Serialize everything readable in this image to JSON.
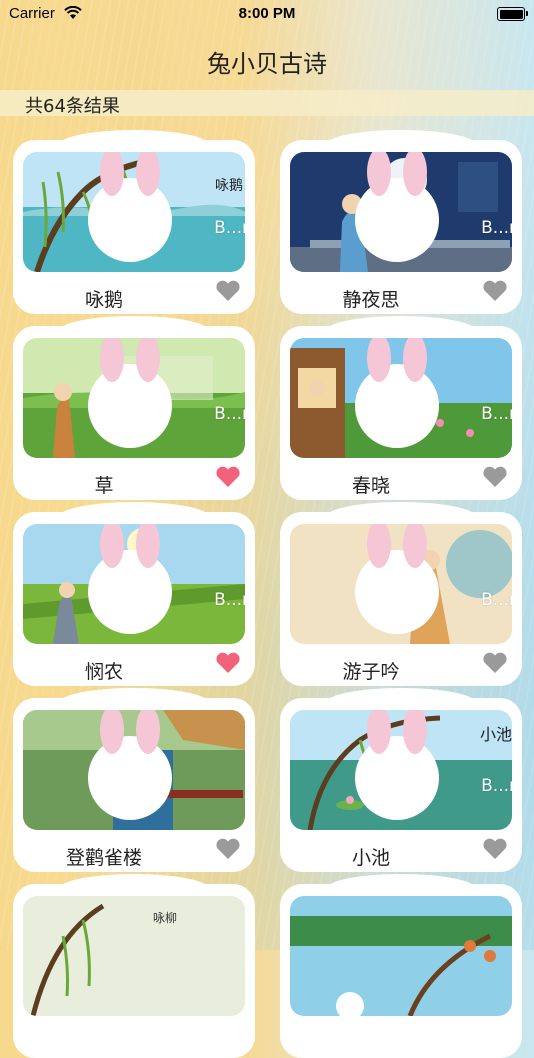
{
  "status_bar": {
    "carrier": "Carrier",
    "time": "8:00 PM"
  },
  "nav": {
    "title": "兔小贝古诗"
  },
  "results": {
    "count_text": "共64条结果"
  },
  "colors": {
    "heart_off": "#9a9a9a",
    "heart_on": "#f2627a"
  },
  "poems": [
    {
      "title": "咏鹅",
      "watermark": "B...r",
      "favorited": false,
      "thumb_icon": "willow-lake-scene"
    },
    {
      "title": "静夜思",
      "watermark": "B...r",
      "favorited": false,
      "thumb_icon": "moon-night-scene"
    },
    {
      "title": "草",
      "watermark": "B...r",
      "favorited": true,
      "thumb_icon": "grass-field-scene"
    },
    {
      "title": "春晓",
      "watermark": "B...r",
      "favorited": false,
      "thumb_icon": "spring-window-scene"
    },
    {
      "title": "悯农",
      "watermark": "B...r",
      "favorited": true,
      "thumb_icon": "farmer-field-scene"
    },
    {
      "title": "游子吟",
      "watermark": "B...r",
      "favorited": false,
      "thumb_icon": "mother-sewing-scene"
    },
    {
      "title": "登鹳雀楼",
      "watermark": "",
      "favorited": false,
      "thumb_icon": "tower-view-scene"
    },
    {
      "title": "小池",
      "watermark": "B...r",
      "favorited": false,
      "thumb_icon": "lotus-pond-scene"
    },
    {
      "title": "",
      "watermark": "",
      "favorited": false,
      "thumb_icon": "willow-scene"
    },
    {
      "title": "",
      "watermark": "",
      "favorited": false,
      "thumb_icon": "river-tree-scene"
    }
  ]
}
